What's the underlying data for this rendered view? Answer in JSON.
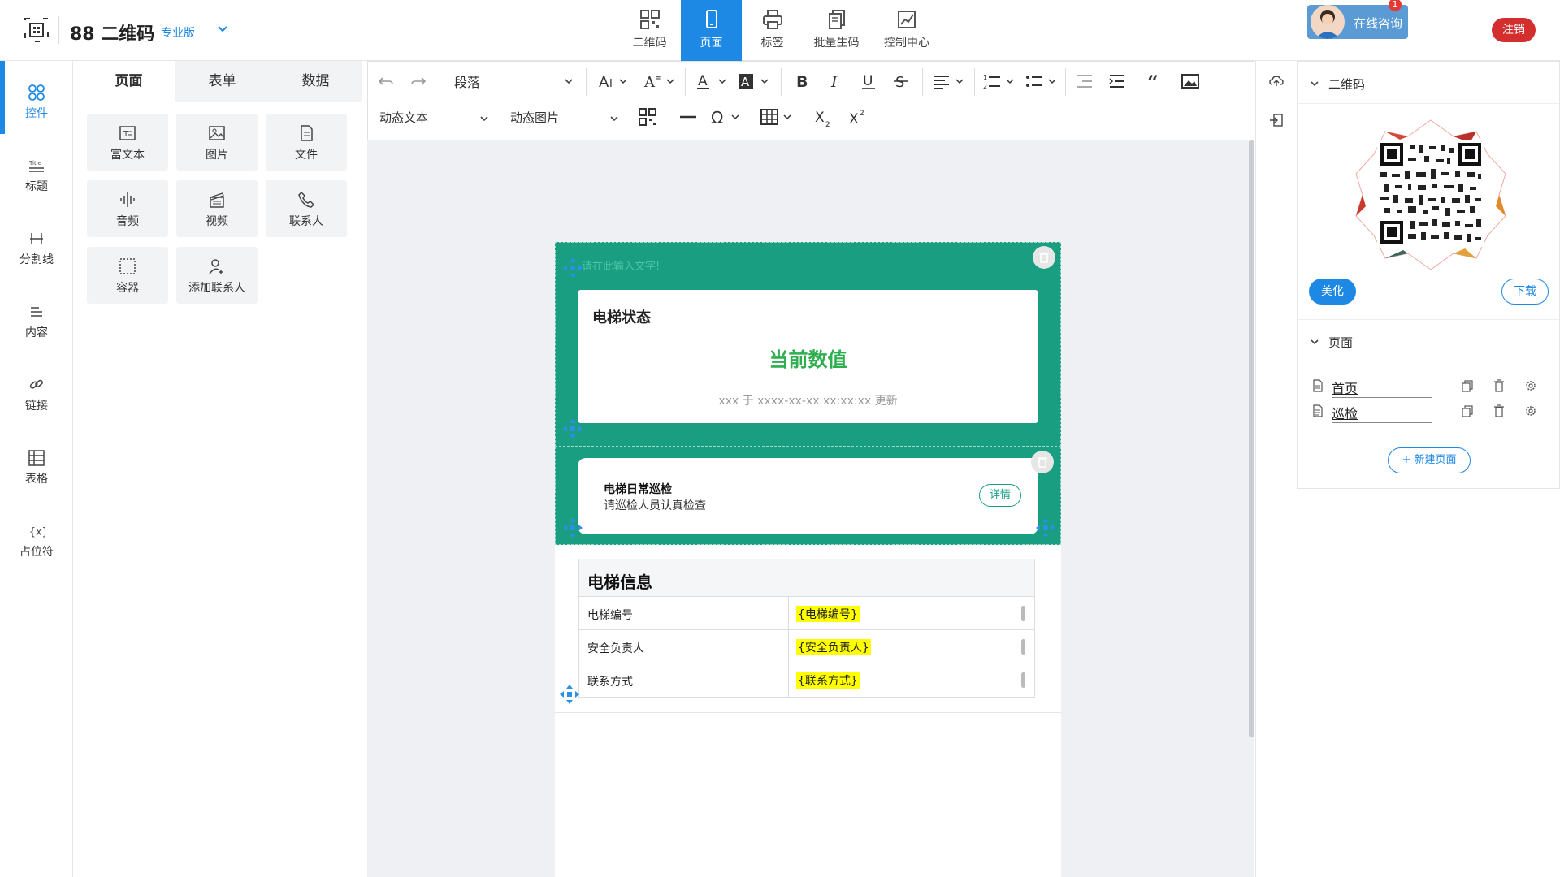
{
  "app": {
    "title": "88 二维码",
    "edition": "专业版"
  },
  "nav": {
    "tabs": [
      {
        "label": "二维码"
      },
      {
        "label": "页面",
        "active": true
      },
      {
        "label": "标签"
      },
      {
        "label": "批量生码"
      },
      {
        "label": "控制中心"
      }
    ]
  },
  "consult": {
    "label": "在线咨询",
    "badge": "1"
  },
  "logout": {
    "label": "注销"
  },
  "rail": {
    "items": [
      {
        "label": "控件",
        "icon": "widgets-icon",
        "active": true
      },
      {
        "label": "标题",
        "icon": "title-icon"
      },
      {
        "label": "分割线",
        "icon": "divider-icon"
      },
      {
        "label": "内容",
        "icon": "content-icon"
      },
      {
        "label": "链接",
        "icon": "link-icon"
      },
      {
        "label": "表格",
        "icon": "table-icon"
      },
      {
        "label": "占位符",
        "icon": "placeholder-icon"
      }
    ]
  },
  "panel": {
    "tabs": [
      "页面",
      "表单",
      "数据"
    ],
    "widgets": [
      "富文本",
      "图片",
      "文件",
      "音频",
      "视频",
      "联系人",
      "容器",
      "添加联系人"
    ]
  },
  "toolbar": {
    "paragraph": "段落",
    "dynamic_text": "动态文本",
    "dynamic_image": "动态图片"
  },
  "canvas": {
    "placeholder_text": "请在此输入文字!",
    "status_card": {
      "title": "电梯状态",
      "value": "当前数值",
      "updated": "xxx 于 xxxx-xx-xx xx:xx:xx 更新"
    },
    "inspection_card": {
      "title": "电梯日常巡检",
      "subtitle": "请巡检人员认真检查",
      "button": "详情"
    },
    "info_table": {
      "title": "电梯信息",
      "rows": [
        {
          "label": "电梯编号",
          "value": "{电梯编号}"
        },
        {
          "label": "安全负责人",
          "value": "{安全负责人}"
        },
        {
          "label": "联系方式",
          "value": "{联系方式}"
        }
      ]
    }
  },
  "right_panel": {
    "qr_section": "二维码",
    "beautify": "美化",
    "download": "下载",
    "pages_section": "页面",
    "pages": [
      "首页",
      "巡检"
    ],
    "new_page": "新建页面"
  },
  "colors": {
    "accent": "#1e88e5",
    "teal": "#199e82",
    "value_green": "#2eae4f",
    "logout_red": "#d32f2f"
  }
}
